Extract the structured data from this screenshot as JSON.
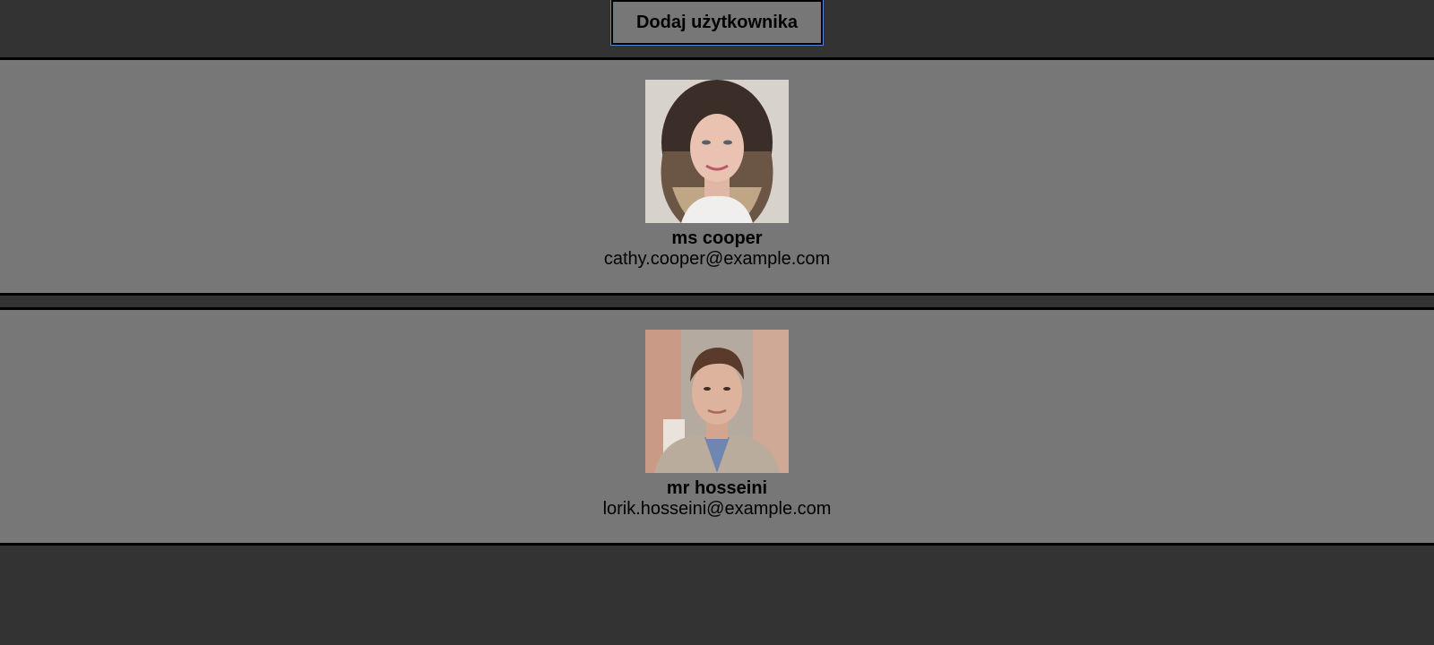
{
  "toolbar": {
    "add_user_label": "Dodaj użytkownika"
  },
  "users": [
    {
      "name": "ms cooper",
      "email": "cathy.cooper@example.com",
      "avatar_icon": "avatar-photo-woman"
    },
    {
      "name": "mr hosseini",
      "email": "lorik.hosseini@example.com",
      "avatar_icon": "avatar-photo-man"
    }
  ],
  "colors": {
    "page_background": "#333333",
    "card_background": "#777777",
    "border": "#000000",
    "button_focus_outline": "#5b7fd6"
  }
}
